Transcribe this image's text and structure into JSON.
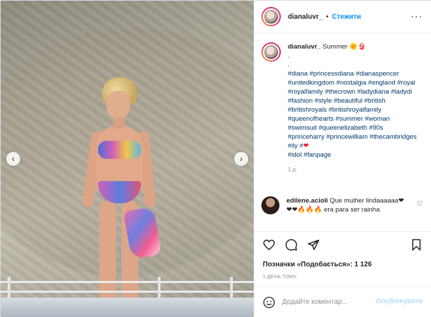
{
  "header": {
    "username": "dianaluvr_",
    "separator": "•",
    "follow_label": "Стежити",
    "more_label": "···"
  },
  "caption": {
    "username": "dianaluvr_",
    "text": "Summer 🌞👙",
    "dots": [
      ".",
      "."
    ],
    "hashtags": "#diana #princessdiana #dianaspencer #unitedkingdom #nostalgia #england #royal #royalfamily #thecrown #ladydiana #ladydi #fashion #style #beautiful #british #britishroyals #britishroyalfamily #queenofhearts #summer #woman #swimsuit #queenelizabeth #90s #princeharry #princewilliam #thecambridges #ily #",
    "heart": "❤",
    "hashtags_end": "#idol #fanpage",
    "time": "1 д."
  },
  "comment": {
    "username": "edilene.acioli",
    "text": "Que mulher lindaaaaaa❤❤❤🔥🔥🔥 era para ser rainha"
  },
  "actions": {
    "likes": "Позначки «Подобається»: 1 126",
    "ago": "1 ДЕНЬ ТОМУ"
  },
  "comment_box": {
    "placeholder": "Додайте коментар...",
    "publish_label": "Опублікувати"
  },
  "colors": {
    "accent": "#0095f6",
    "hashtag": "#00376b",
    "publish_disabled": "#b2dffc",
    "heart": "#ed1b2e"
  }
}
